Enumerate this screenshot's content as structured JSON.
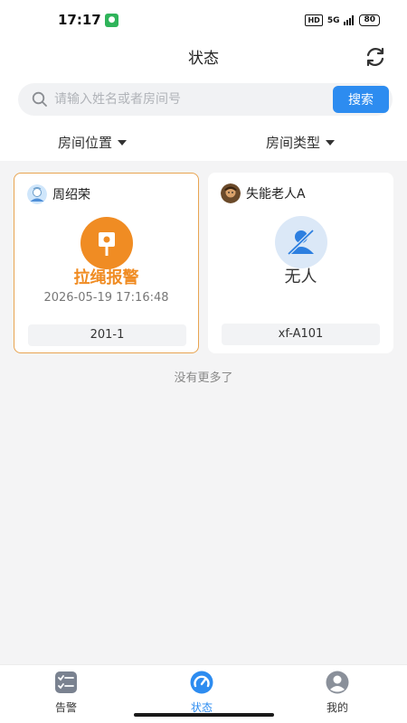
{
  "status_bar": {
    "time": "17:17",
    "hd": "HD",
    "signal": "5G",
    "battery": "80"
  },
  "header": {
    "title": "状态",
    "refresh_icon": "refresh-icon"
  },
  "search": {
    "placeholder": "请输入姓名或者房间号",
    "value": "",
    "button_label": "搜索"
  },
  "filters": {
    "room_position": "房间位置",
    "room_type": "房间类型"
  },
  "cards": [
    {
      "name": "周绍荣",
      "status": "拉绳报警",
      "time": "2026-05-19 17:16:48",
      "room": "201-1",
      "status_icon": "alarm-sign-icon",
      "accent": "#f08c23"
    },
    {
      "name": "失能老人A",
      "status": "无人",
      "room": "xf-A101",
      "status_icon": "no-person-icon",
      "accent": "#2d7fe0"
    }
  ],
  "list_footer": "没有更多了",
  "bottom_nav": [
    {
      "label": "告警",
      "icon": "checklist-icon"
    },
    {
      "label": "状态",
      "icon": "dashboard-icon",
      "active": true
    },
    {
      "label": "我的",
      "icon": "user-icon"
    }
  ],
  "colors": {
    "primary": "#2d8cf0",
    "alarm": "#f08c23",
    "card_border_alarm": "#e8a450"
  }
}
